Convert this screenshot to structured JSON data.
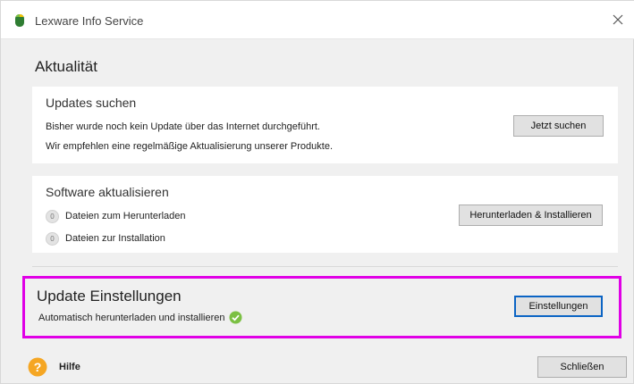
{
  "window": {
    "title": "Lexware Info Service"
  },
  "section": {
    "title": "Aktualität"
  },
  "updates_card": {
    "title": "Updates suchen",
    "line1": "Bisher wurde noch kein Update über das Internet durchgeführt.",
    "line2": "Wir empfehlen eine regelmäßige Aktualisierung unserer Produkte.",
    "button": "Jetzt suchen"
  },
  "software_card": {
    "title": "Software aktualisieren",
    "items": [
      {
        "count": "0",
        "label": "Dateien zum Herunterladen"
      },
      {
        "count": "0",
        "label": "Dateien zur Installation"
      }
    ],
    "button": "Herunterladen & Installieren"
  },
  "settings": {
    "title": "Update Einstellungen",
    "text": "Automatisch herunterladen und installieren",
    "button": "Einstellungen",
    "status": "enabled"
  },
  "footer": {
    "help_label": "Hilfe",
    "close_button": "Schließen"
  },
  "colors": {
    "highlight": "#e000e6",
    "accent": "#0b64c4",
    "check": "#7bc043",
    "help": "#f5a623"
  },
  "icons": [
    "lexware-logo-icon",
    "close-icon",
    "check-circle-icon",
    "help-icon"
  ]
}
